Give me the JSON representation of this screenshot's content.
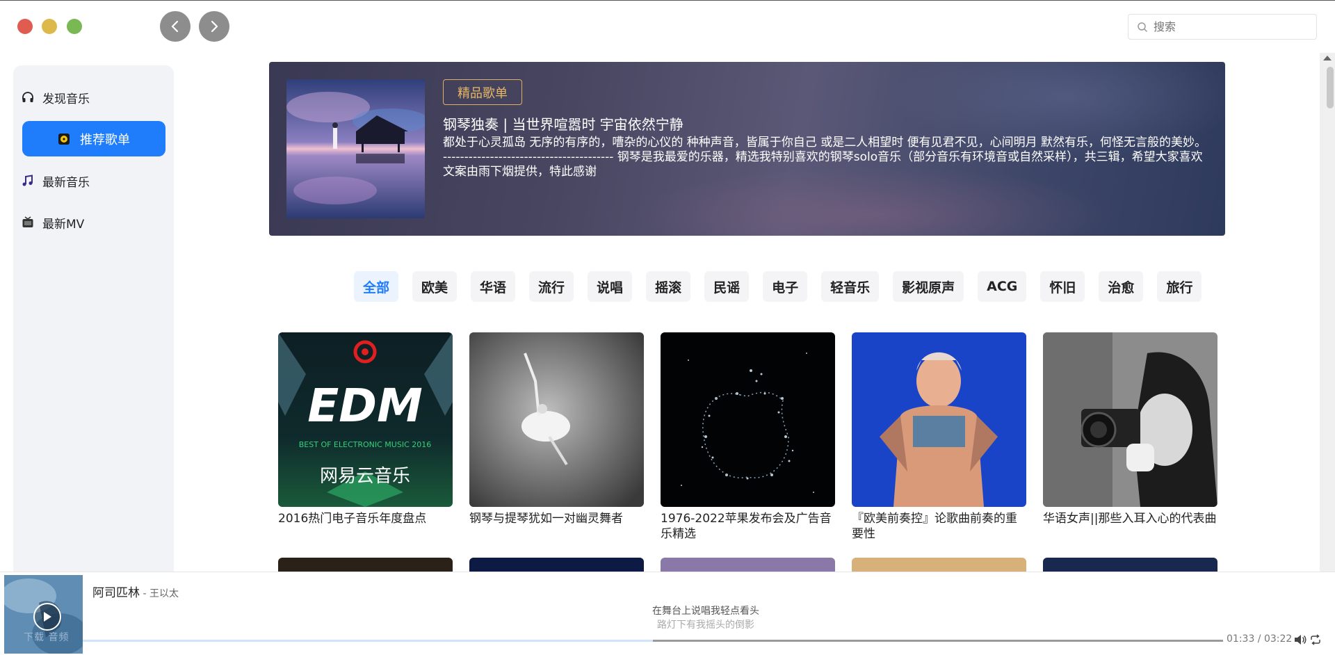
{
  "window": {
    "controls": [
      "close",
      "minimize",
      "maximize"
    ],
    "nav": {
      "back_icon": "chevron-left-icon",
      "forward_icon": "chevron-right-icon"
    }
  },
  "search": {
    "placeholder": "搜索",
    "icon": "search-icon"
  },
  "sidebar": {
    "items": [
      {
        "label": "发现音乐",
        "icon": "headphones-icon",
        "active": false
      },
      {
        "label": "推荐歌单",
        "icon": "playlist-icon",
        "active": true
      },
      {
        "label": "最新音乐",
        "icon": "music-note-icon",
        "active": false
      },
      {
        "label": "最新MV",
        "icon": "tv-icon",
        "active": false
      }
    ],
    "active_color": "#1f7dfb"
  },
  "banner": {
    "tag": "精品歌单",
    "title": "钢琴独奏 | 当世界喧嚣时 宇宙依然宁静",
    "description": "都处于心灵孤岛 无序的有序的，嘈杂的心仪的 种种声音，皆属于你自己 或是二人相望时 便有见君不见，心间明月 默然有乐，何怪无言般的美妙。 ---------------------------------------- 钢琴是我最爱的乐器，精选我特别喜欢的钢琴solo音乐（部分音乐有环境音或自然采样），共三辑，希望大家喜欢 文案由雨下烟提供，特此感谢",
    "tag_color": "#e8b764"
  },
  "categories": {
    "items": [
      "全部",
      "欧美",
      "华语",
      "流行",
      "说唱",
      "摇滚",
      "民谣",
      "电子",
      "轻音乐",
      "影视原声",
      "ACG",
      "怀旧",
      "治愈",
      "旅行"
    ],
    "selected": "全部"
  },
  "playlists": [
    {
      "name": "2016热门电子音乐年度盘点",
      "cover_text": "EDM",
      "cover_sub": "BEST OF ELECTRONIC MUSIC 2016",
      "cover_brand": "网易云音乐"
    },
    {
      "name": "钢琴与提琴犹如一对幽灵舞者"
    },
    {
      "name": "1976-2022苹果发布会及广告音乐精选"
    },
    {
      "name": "『欧美前奏控』论歌曲前奏的重要性"
    },
    {
      "name": "华语女声||那些入耳入心的代表曲"
    }
  ],
  "player": {
    "song": "阿司匹林",
    "artist": " - 王以太",
    "lyric_current": "在舞台上说唱我轻点看头",
    "lyric_next": "路灯下有我摇头的倒影",
    "time": "01:33 / 03:22",
    "progress": 0.5,
    "download_text": "下载 音频",
    "icons": [
      "play-icon",
      "volume-icon",
      "loop-icon"
    ]
  }
}
